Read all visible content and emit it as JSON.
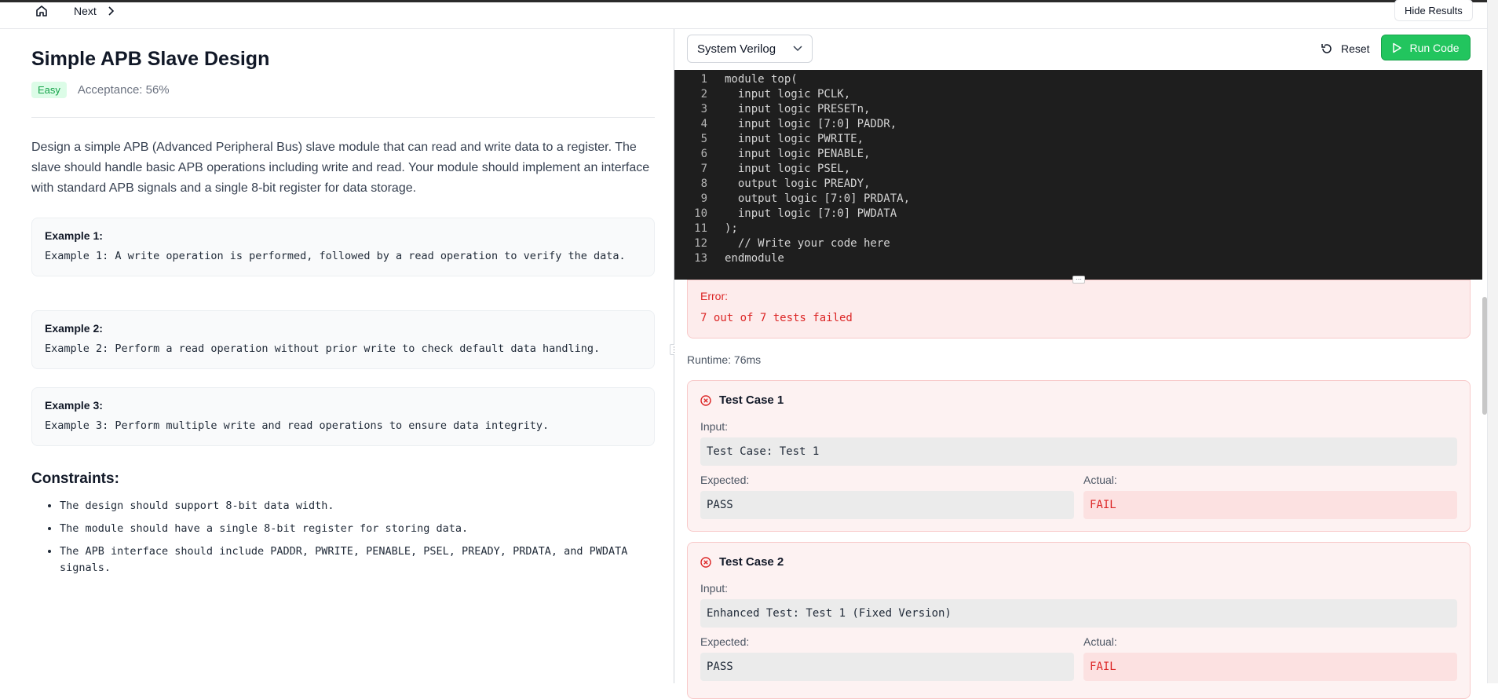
{
  "nav": {
    "next_label": "Next",
    "hide_results_label": "Hide Results"
  },
  "problem": {
    "title": "Simple APB Slave Design",
    "difficulty": "Easy",
    "acceptance": "Acceptance: 56%",
    "description": "Design a simple APB (Advanced Peripheral Bus) slave module that can read and write data to a register. The slave should handle basic APB operations including write and read. Your module should implement an interface with standard APB signals and a single 8-bit register for data storage.",
    "examples": [
      {
        "title": "Example 1:",
        "text": "Example 1: A write operation is performed, followed by a read operation to verify the data."
      },
      {
        "title": "Example 2:",
        "text": "Example 2: Perform a read operation without prior write to check default data handling."
      },
      {
        "title": "Example 3:",
        "text": "Example 3: Perform multiple write and read operations to ensure data integrity."
      }
    ],
    "constraints_title": "Constraints:",
    "constraints": [
      "The design should support 8-bit data width.",
      "The module should have a single 8-bit register for storing data.",
      "The APB interface should include PADDR, PWRITE, PENABLE, PSEL, PREADY, PRDATA, and PWDATA signals."
    ]
  },
  "toolbar": {
    "language": "System Verilog",
    "reset_label": "Reset",
    "run_label": "Run Code"
  },
  "editor": {
    "lines": [
      {
        "n": "1",
        "code": "module top("
      },
      {
        "n": "2",
        "code": "  input logic PCLK,"
      },
      {
        "n": "3",
        "code": "  input logic PRESETn,"
      },
      {
        "n": "4",
        "code": "  input logic [7:0] PADDR,"
      },
      {
        "n": "5",
        "code": "  input logic PWRITE,"
      },
      {
        "n": "6",
        "code": "  input logic PENABLE,"
      },
      {
        "n": "7",
        "code": "  input logic PSEL,"
      },
      {
        "n": "8",
        "code": "  output logic PREADY,"
      },
      {
        "n": "9",
        "code": "  output logic [7:0] PRDATA,"
      },
      {
        "n": "10",
        "code": "  input logic [7:0] PWDATA"
      },
      {
        "n": "11",
        "code": ");"
      },
      {
        "n": "12",
        "code": "  // Write your code here"
      },
      {
        "n": "13",
        "code": "endmodule"
      }
    ]
  },
  "results": {
    "error_title": "Error:",
    "error_message": "7 out of 7 tests failed",
    "runtime": "Runtime: 76ms",
    "test_cases": [
      {
        "title": "Test Case 1",
        "input_label": "Input:",
        "input": "Test Case: Test 1",
        "expected_label": "Expected:",
        "expected": "PASS",
        "actual_label": "Actual:",
        "actual": "FAIL"
      },
      {
        "title": "Test Case 2",
        "input_label": "Input:",
        "input": "Enhanced Test: Test 1 (Fixed Version)",
        "expected_label": "Expected:",
        "expected": "PASS",
        "actual_label": "Actual:",
        "actual": "FAIL"
      }
    ]
  },
  "colors": {
    "run_button": "#22c55e",
    "error_text": "#dc2626",
    "easy_badge": "#16a34a"
  }
}
